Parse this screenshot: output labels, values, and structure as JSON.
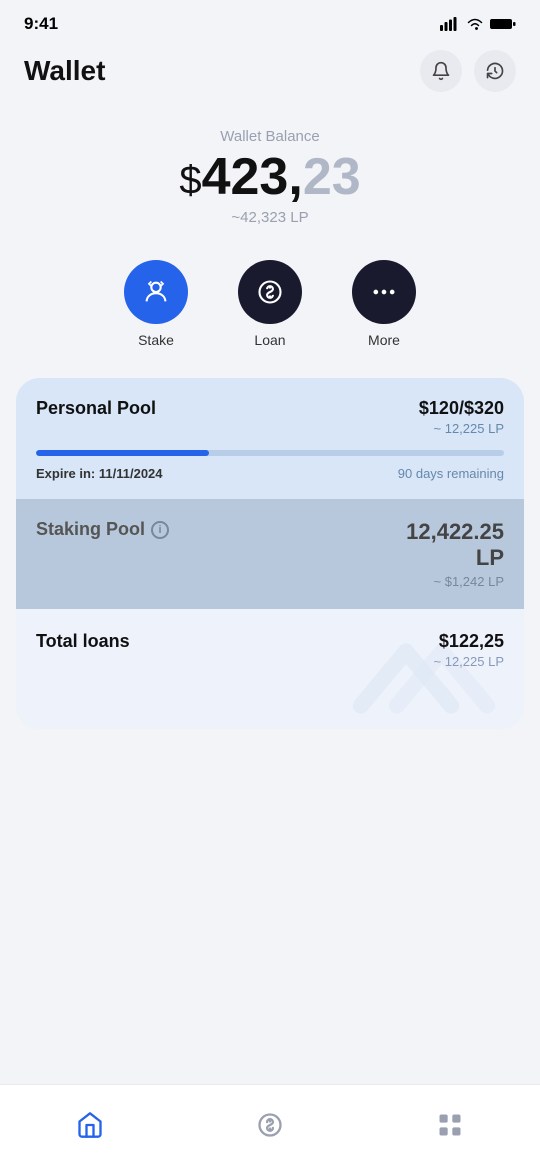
{
  "statusBar": {
    "time": "9:41"
  },
  "header": {
    "title": "Wallet",
    "notificationIcon": "bell",
    "historyIcon": "history"
  },
  "balance": {
    "label": "Wallet Balance",
    "dollarSign": "$",
    "mainAmount": "423,",
    "decimalAmount": "23",
    "lpAmount": "~42,323 LP"
  },
  "actions": [
    {
      "id": "stake",
      "label": "Stake",
      "icon": "stake",
      "style": "blue"
    },
    {
      "id": "loan",
      "label": "Loan",
      "icon": "loan",
      "style": "dark"
    },
    {
      "id": "more",
      "label": "More",
      "icon": "more",
      "style": "dark"
    }
  ],
  "personalPool": {
    "title": "Personal Pool",
    "amount": "$120/$320",
    "amountSub": "~ 12,225 LP",
    "progressPercent": 37,
    "expireLabel": "Expire in:",
    "expireDate": "11/11/2024",
    "daysRemaining": "90 days remaining"
  },
  "stakingPool": {
    "title": "Staking Pool",
    "infoIcon": "i",
    "amount": "12,422.25",
    "amountUnit": "LP",
    "amountSub": "~ $1,242 LP"
  },
  "totalLoans": {
    "title": "Total loans",
    "amount": "$122,25",
    "amountSub": "~ 12,225 LP"
  },
  "bottomNav": [
    {
      "id": "home",
      "icon": "home",
      "active": true
    },
    {
      "id": "dollar",
      "icon": "dollar",
      "active": false
    },
    {
      "id": "apps",
      "icon": "apps",
      "active": false
    }
  ]
}
